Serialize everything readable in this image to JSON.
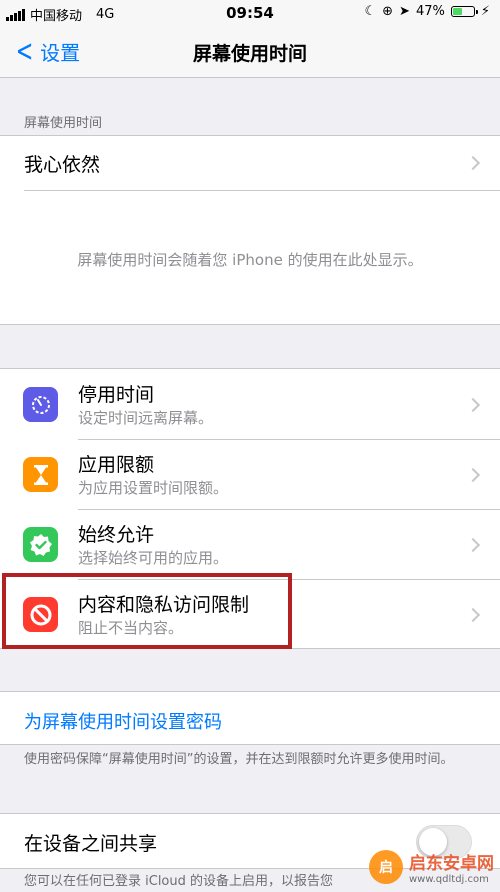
{
  "status_bar": {
    "carrier": "中国移动",
    "network": "4G",
    "time": "09:54",
    "battery": "47%",
    "battery_level": 0.47
  },
  "nav": {
    "back_label": "设置",
    "title": "屏幕使用时间"
  },
  "section1": {
    "header": "屏幕使用时间",
    "device_name": "我心依然",
    "placeholder": "屏幕使用时间会随着您 iPhone 的使用在此处显示。"
  },
  "apps": [
    {
      "title": "停用时间",
      "subtitle": "设定时间远离屏幕。",
      "icon": "downtime-icon",
      "color": "#5e5ce6"
    },
    {
      "title": "应用限额",
      "subtitle": "为应用设置时间限额。",
      "icon": "hourglass-icon",
      "color": "#ff9500"
    },
    {
      "title": "始终允许",
      "subtitle": "选择始终可用的应用。",
      "icon": "checkmark-badge-icon",
      "color": "#34c759"
    },
    {
      "title": "内容和隐私访问限制",
      "subtitle": "阻止不当内容。",
      "icon": "prohibited-icon",
      "color": "#ff3b30"
    }
  ],
  "passcode": {
    "link": "为屏幕使用时间设置密码",
    "note": "使用密码保障“屏幕使用时间”的设置，并在达到限额时允许更多使用时间。"
  },
  "share": {
    "label": "在设备之间共享",
    "enabled": false,
    "note": "您可以在任何已登录 iCloud 的设备上启用，以报告您"
  },
  "watermark": {
    "logo": "启",
    "title": "启东安卓网",
    "url": "www.qdltdj.com"
  }
}
